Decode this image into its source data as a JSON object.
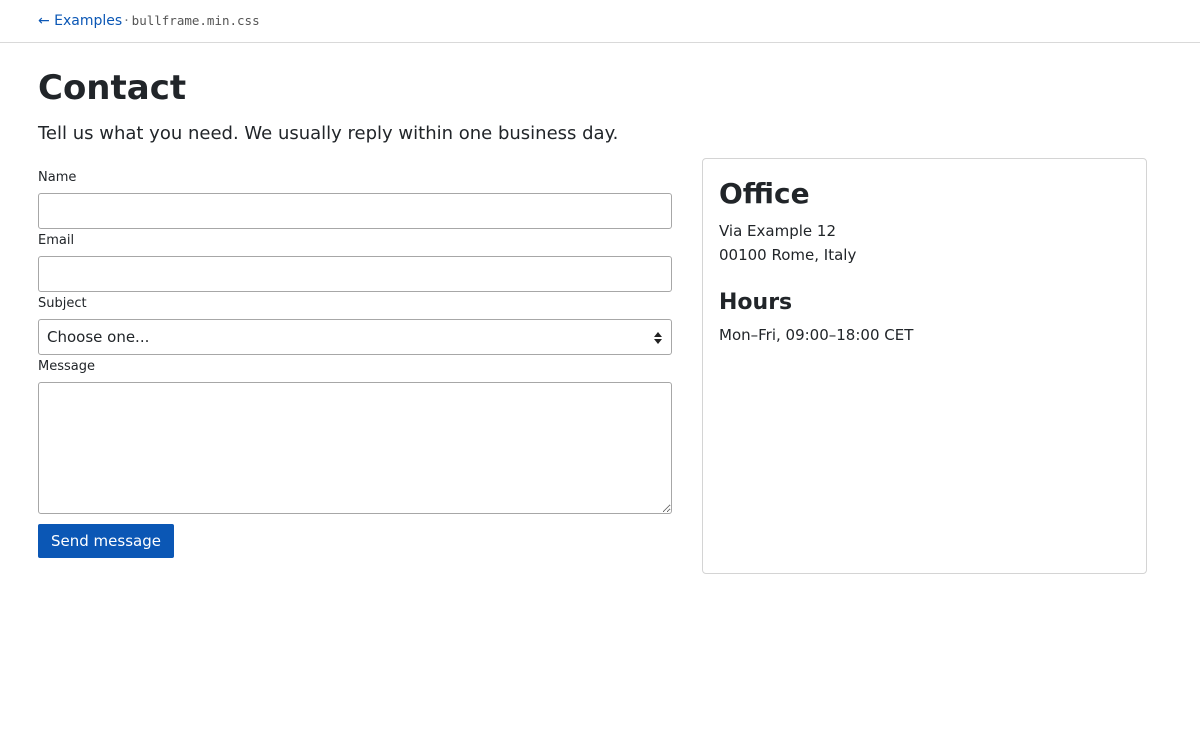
{
  "topbar": {
    "back_link": "← Examples",
    "separator": "·",
    "library": "bullframe.min.css"
  },
  "header": {
    "title": "Contact",
    "lead": "Tell us what you need. We usually reply within one business day."
  },
  "form": {
    "name_label": "Name",
    "name_value": "",
    "email_label": "Email",
    "email_value": "",
    "subject_label": "Subject",
    "subject_selected": "Choose one...",
    "message_label": "Message",
    "message_value": "",
    "submit_label": "Send message"
  },
  "office": {
    "title": "Office",
    "address_line1": "Via Example 12",
    "address_line2": "00100 Rome, Italy",
    "hours_title": "Hours",
    "hours_text": "Mon–Fri, 09:00–18:00 CET"
  },
  "colors": {
    "accent": "#0b57b5",
    "text": "#212529",
    "border": "#a7a7a7"
  }
}
